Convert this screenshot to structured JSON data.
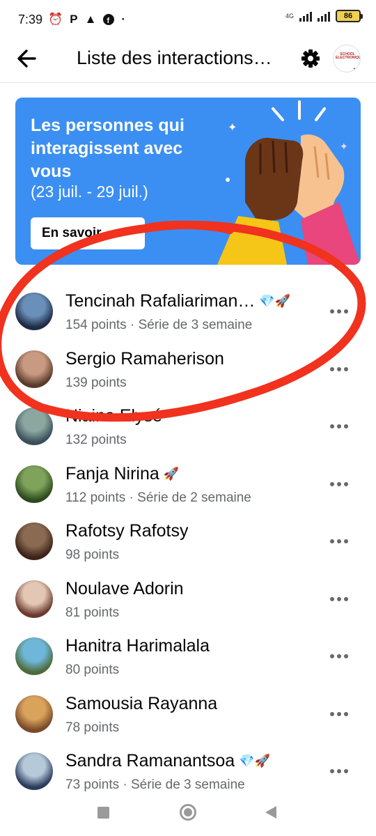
{
  "status_bar": {
    "time": "7:39",
    "icons": [
      "alarm-icon",
      "parking-icon",
      "warning-icon",
      "facebook-icon"
    ],
    "network": "4G",
    "battery": "86"
  },
  "header": {
    "title": "Liste des interactions…",
    "back_icon": "arrow-left-icon",
    "settings_icon": "gear-icon",
    "page_avatar_text": "SCHOOL ELECTRONIQUE"
  },
  "banner": {
    "title": "Les personnes qui interagissent avec vous",
    "dates": "(23 juil. - 29 juil.)",
    "button_label": "En savoir…",
    "background": "#3b8ff2"
  },
  "people": [
    {
      "name": "Tencinah Rafaliariman…",
      "badges": "💎🚀",
      "meta": "154 points  ·  Série de 3 semaine",
      "avatar_colors": [
        "#6a8fb8",
        "#1d2b45"
      ]
    },
    {
      "name": "Sergio Ramaherison",
      "badges": "",
      "meta": "139 points",
      "avatar_colors": [
        "#c99a82",
        "#5a3a2a"
      ]
    },
    {
      "name": "Niaina Elysé",
      "badges": "",
      "meta": "132 points",
      "avatar_colors": [
        "#8ba7a0",
        "#3a4f5a"
      ]
    },
    {
      "name": "Fanja Nirina",
      "badges": "🚀",
      "meta": "112 points  ·  Série de 2 semaine",
      "avatar_colors": [
        "#7fa35a",
        "#2d4a1e"
      ]
    },
    {
      "name": "Rafotsy Rafotsy",
      "badges": "",
      "meta": "98 points",
      "avatar_colors": [
        "#8b6a52",
        "#3b2418"
      ]
    },
    {
      "name": "Noulave Adorin",
      "badges": "",
      "meta": "81 points",
      "avatar_colors": [
        "#e3c7b5",
        "#6b3a2e"
      ]
    },
    {
      "name": "Hanitra Harimalala",
      "badges": "",
      "meta": "80 points",
      "avatar_colors": [
        "#6fb7d9",
        "#4c6b3a"
      ]
    },
    {
      "name": "Samousia Rayanna",
      "badges": "",
      "meta": "78 points",
      "avatar_colors": [
        "#d9a35c",
        "#7a4a2a"
      ]
    },
    {
      "name": "Sandra Ramanantsoa",
      "badges": "💎🚀",
      "meta": "73 points  ·  Série de 3 semaine",
      "avatar_colors": [
        "#b5c9d9",
        "#2a3b5c"
      ]
    }
  ],
  "annotation": {
    "color": "#f0321e"
  }
}
